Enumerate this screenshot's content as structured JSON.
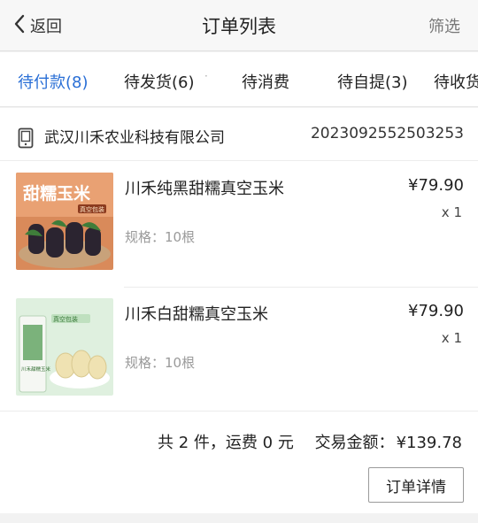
{
  "header": {
    "back_label": "返回",
    "title": "订单列表",
    "filter_label": "筛选"
  },
  "tabs": [
    {
      "label": "待付款(8)",
      "active": true
    },
    {
      "label": "待发货(6)"
    },
    {
      "label": "待消费"
    },
    {
      "label": "待自提(3)"
    },
    {
      "label": "待收货"
    }
  ],
  "tab_dot": "·",
  "order": {
    "shop_icon": "phone-icon",
    "shop_name": "武汉川禾农业科技有限公司",
    "order_number": "2023092552503253",
    "items": [
      {
        "name": "川禾纯黑甜糯真空玉米",
        "spec": "规格：10根",
        "price": "¥79.90",
        "qty": "x 1",
        "image_text": "甜糯玉米",
        "image_tag": "真空包装"
      },
      {
        "name": "川禾白甜糯真空玉米",
        "spec": "规格：10根",
        "price": "¥79.90",
        "qty": "x 1",
        "image_text": "真空包装",
        "image_tag": "川禾甜糯玉米"
      }
    ],
    "summary": {
      "count_text": "共 2 件，运费 0 元",
      "amount_label": "交易金额：",
      "amount": "¥139.78"
    },
    "detail_button": "订单详情"
  },
  "colors": {
    "accent": "#2a6fd6",
    "background": "#f2f2f2",
    "card": "#ffffff"
  }
}
